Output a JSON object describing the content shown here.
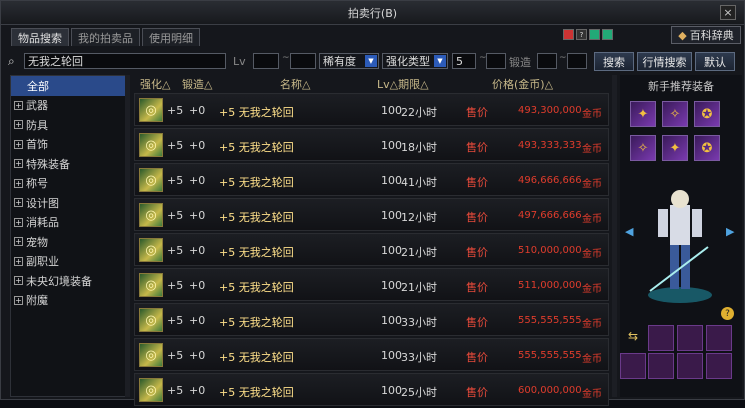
{
  "title": "拍卖行(B)",
  "close": "×",
  "tabs": [
    "物品搜索",
    "我的拍卖品",
    "使用明细"
  ],
  "dict_label": "百科辞典",
  "search": {
    "value": "无我之轮回",
    "lv_label": "Lv",
    "rarity": "稀有度",
    "enhance_type": "强化类型",
    "enhance_value": "5",
    "forge_label": "锻造"
  },
  "buttons": {
    "search": "搜索",
    "market": "行情搜索",
    "default": "默认"
  },
  "sidebar": [
    "全部",
    "武器",
    "防具",
    "首饰",
    "特殊装备",
    "称号",
    "设计图",
    "消耗品",
    "宠物",
    "副职业",
    "未央幻境装备",
    "附魔"
  ],
  "columns": [
    "强化△",
    "锻造△",
    "名称△",
    "Lv△期限△",
    "价格(金币)△"
  ],
  "rows": [
    {
      "enh": "+5",
      "forge": "+0",
      "name": "+5 无我之轮回",
      "lv": "100",
      "period": "22小时",
      "sale": "售价",
      "price": "493,300,000",
      "unit": "金币"
    },
    {
      "enh": "+5",
      "forge": "+0",
      "name": "+5 无我之轮回",
      "lv": "100",
      "period": "18小时",
      "sale": "售价",
      "price": "493,333,333",
      "unit": "金币"
    },
    {
      "enh": "+5",
      "forge": "+0",
      "name": "+5 无我之轮回",
      "lv": "100",
      "period": "41小时",
      "sale": "售价",
      "price": "496,666,666",
      "unit": "金币"
    },
    {
      "enh": "+5",
      "forge": "+0",
      "name": "+5 无我之轮回",
      "lv": "100",
      "period": "12小时",
      "sale": "售价",
      "price": "497,666,666",
      "unit": "金币"
    },
    {
      "enh": "+5",
      "forge": "+0",
      "name": "+5 无我之轮回",
      "lv": "100",
      "period": "21小时",
      "sale": "售价",
      "price": "510,000,000",
      "unit": "金币"
    },
    {
      "enh": "+5",
      "forge": "+0",
      "name": "+5 无我之轮回",
      "lv": "100",
      "period": "21小时",
      "sale": "售价",
      "price": "511,000,000",
      "unit": "金币"
    },
    {
      "enh": "+5",
      "forge": "+0",
      "name": "+5 无我之轮回",
      "lv": "100",
      "period": "33小时",
      "sale": "售价",
      "price": "555,555,555",
      "unit": "金币"
    },
    {
      "enh": "+5",
      "forge": "+0",
      "name": "+5 无我之轮回",
      "lv": "100",
      "period": "33小时",
      "sale": "售价",
      "price": "555,555,555",
      "unit": "金币"
    },
    {
      "enh": "+5",
      "forge": "+0",
      "name": "+5 无我之轮回",
      "lv": "100",
      "period": "25小时",
      "sale": "售价",
      "price": "600,000,000",
      "unit": "金币"
    }
  ],
  "right_title": "新手推荐装备"
}
